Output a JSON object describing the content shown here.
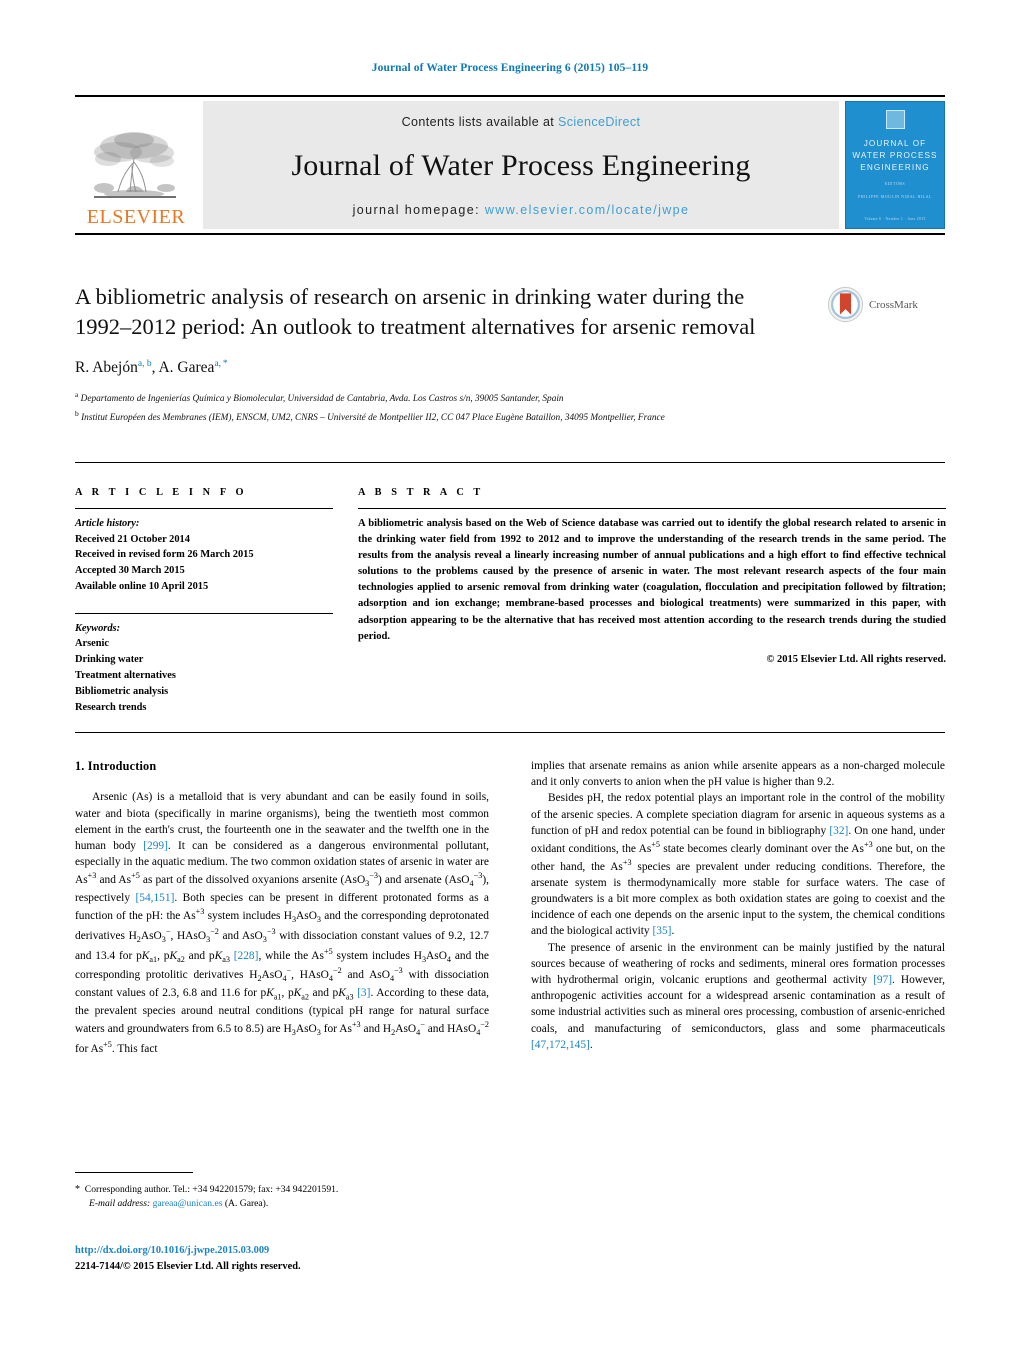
{
  "running_head": "Journal of Water Process Engineering 6 (2015) 105–119",
  "masthead": {
    "contents_prefix": "Contents lists available at ",
    "sciencedirect": "ScienceDirect",
    "journal_name": "Journal of Water Process Engineering",
    "homepage_prefix": "journal homepage: ",
    "homepage_url": "www.elsevier.com/locate/jwpe",
    "publisher": "ELSEVIER",
    "cover": {
      "title_line1": "JOURNAL OF",
      "title_line2": "WATER PROCESS",
      "title_line3": "ENGINEERING",
      "editors_label": "EDITORS",
      "editors": "PHILIPPE MOULIN   NIDAL HILAL",
      "footer": "Volume 6  ·  Number 1  ·  June 2015"
    }
  },
  "article": {
    "title": "A bibliometric analysis of research on arsenic in drinking water during the 1992–2012 period: An outlook to treatment alternatives for arsenic removal",
    "crossmark_label": "CrossMark",
    "authors_html": "R. Abejón<sup>a, b</sup>, A. Garea<sup>a, *</sup>",
    "affiliation_a": "Departamento de Ingenierías Química y Biomolecular, Universidad de Cantabria, Avda. Los Castros s/n, 39005 Santander, Spain",
    "affiliation_b": "Institut Européen des Membranes (IEM), ENSCM, UM2, CNRS – Université de Montpellier II2, CC 047 Place Eugène Bataillon, 34095 Montpellier, France"
  },
  "info": {
    "heading": "A R T I C L E   I N F O",
    "history_label": "Article history:",
    "history": [
      "Received 21 October 2014",
      "Received in revised form 26 March 2015",
      "Accepted 30 March 2015",
      "Available online 10 April 2015"
    ],
    "keywords_label": "Keywords:",
    "keywords": [
      "Arsenic",
      "Drinking water",
      "Treatment alternatives",
      "Bibliometric analysis",
      "Research trends"
    ]
  },
  "abstract": {
    "heading": "A B S T R A C T",
    "text": "A bibliometric analysis based on the Web of Science database was carried out to identify the global research related to arsenic in the drinking water field from 1992 to 2012 and to improve the understanding of the research trends in the same period. The results from the analysis reveal a linearly increasing number of annual publications and a high effort to find effective technical solutions to the problems caused by the presence of arsenic in water. The most relevant research aspects of the four main technologies applied to arsenic removal from drinking water (coagulation, flocculation and precipitation followed by filtration; adsorption and ion exchange; membrane-based processes and biological treatments) were summarized in this paper, with adsorption appearing to be the alternative that has received most attention according to the research trends during the studied period.",
    "copyright": "© 2015 Elsevier Ltd. All rights reserved."
  },
  "body": {
    "section_number_title": "1.  Introduction",
    "left_paragraph_html": "Arsenic (As) is a metalloid that is very abundant and can be easily found in soils, water and biota (specifically in marine organisms), being the twentieth most common element in the earth's crust, the fourteenth one in the seawater and the twelfth one in the human body <span class=\"ref\">[299]</span>. It can be considered as a dangerous environmental pollutant, especially in the aquatic medium. The two common oxidation states of arsenic in water are As<sup>+3</sup> and As<sup>+5</sup> as part of the dissolved oxyanions arsenite (AsO<sub>3</sub><sup>−3</sup>) and arsenate (AsO<sub>4</sub><sup>−3</sup>), respectively <span class=\"ref\">[54,151]</span>. Both species can be present in different protonated forms as a function of the pH: the As<sup>+3</sup> system includes H<sub>3</sub>AsO<sub>3</sub> and the corresponding deprotonated derivatives H<sub>2</sub>AsO<sub>3</sub><sup>−</sup>, HAsO<sub>3</sub><sup>−2</sup> and AsO<sub>3</sub><sup>−3</sup> with dissociation constant values of 9.2, 12.7 and 13.4 for p<i>K</i><sub>a1</sub>, p<i>K</i><sub>a2</sub> and p<i>K</i><sub>a3</sub> <span class=\"ref\">[228]</span>, while the As<sup>+5</sup> system includes H<sub>3</sub>AsO<sub>4</sub> and the corresponding protolitic derivatives H<sub>2</sub>AsO<sub>4</sub><sup>−</sup>, HAsO<sub>4</sub><sup>−2</sup> and AsO<sub>4</sub><sup>−3</sup> with dissociation constant values of 2.3, 6.8 and 11.6 for p<i>K</i><sub>a1</sub>, p<i>K</i><sub>a2</sub> and p<i>K</i><sub>a3</sub> <span class=\"ref\">[3]</span>. According to these data, the prevalent species around neutral conditions (typical pH range for natural surface waters and groundwaters from 6.5 to 8.5) are H<sub>3</sub>AsO<sub>3</sub> for As<sup>+3</sup> and H<sub>2</sub>AsO<sub>4</sub><sup>−</sup> and HAsO<sub>4</sub><sup>−2</sup> for As<sup>+5</sup>. This fact",
    "right_paragraph_1_html": "implies that arsenate remains as anion while arsenite appears as a non-charged molecule and it only converts to anion when the pH value is higher than 9.2.",
    "right_paragraph_2_html": "Besides pH, the redox potential plays an important role in the control of the mobility of the arsenic species. A complete speciation diagram for arsenic in aqueous systems as a function of pH and redox potential can be found in bibliography <span class=\"ref\">[32]</span>. On one hand, under oxidant conditions, the As<sup>+5</sup> state becomes clearly dominant over the As<sup>+3</sup> one but, on the other hand, the As<sup>+3</sup> species are prevalent under reducing conditions. Therefore, the arsenate system is thermodynamically more stable for surface waters. The case of groundwaters is a bit more complex as both oxidation states are going to coexist and the incidence of each one depends on the arsenic input to the system, the chemical conditions and the biological activity <span class=\"ref\">[35]</span>.",
    "right_paragraph_3_html": "The presence of arsenic in the environment can be mainly justified by the natural sources because of weathering of rocks and sediments, mineral ores formation processes with hydrothermal origin, volcanic eruptions and geothermal activity <span class=\"ref\">[97]</span>. However, anthropogenic activities account for a widespread arsenic contamination as a result of some industrial activities such as mineral ores processing, combustion of arsenic-enriched coals, and manufacturing of semiconductors, glass and some pharmaceuticals <span class=\"ref\">[47,172,145]</span>."
  },
  "footnote": {
    "corresponding_html": "<span class=\"star\">*</span>&nbsp; Corresponding author. Tel.: +34 942201579; fax: +34 942201591.",
    "email_label": "E-mail address:",
    "email": "gareaa@unican.es",
    "email_suffix": "(A. Garea)."
  },
  "doi": {
    "link": "http://dx.doi.org/10.1016/j.jwpe.2015.03.009",
    "issn_line": "2214-7144/© 2015 Elsevier Ltd. All rights reserved."
  },
  "colors": {
    "link_blue": "#1a84c7",
    "header_blue": "#0b7ab5",
    "elsevier_orange": "#E87722",
    "cover_blue": "#1f8fd0",
    "masthead_grey": "#e9e9e9"
  }
}
